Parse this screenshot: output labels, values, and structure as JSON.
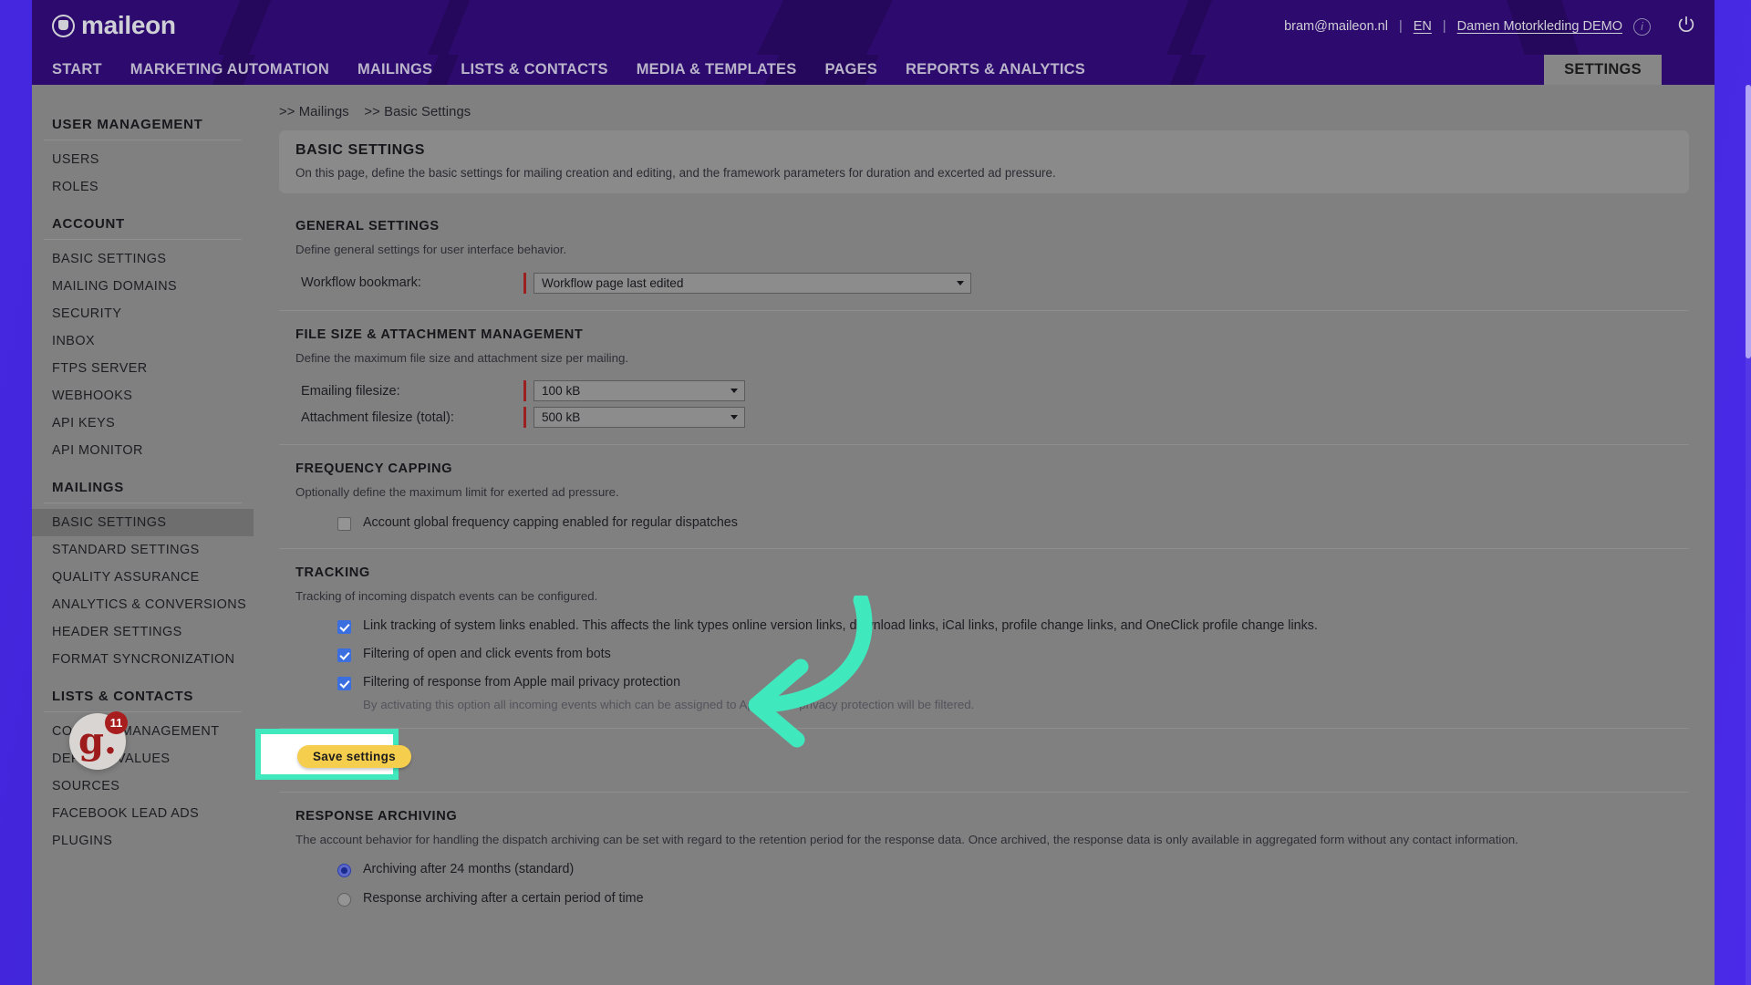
{
  "brand": {
    "name": "maileon",
    "mark_icon": "maileon-logo-icon"
  },
  "header": {
    "user_email": "bram@maileon.nl",
    "separator": "|",
    "language": "EN",
    "account": "Damen Motorkleding DEMO",
    "info_icon": "info-icon",
    "power_icon": "power-icon"
  },
  "nav": {
    "items": [
      {
        "label": "START"
      },
      {
        "label": "MARKETING AUTOMATION"
      },
      {
        "label": "MAILINGS"
      },
      {
        "label": "LISTS & CONTACTS"
      },
      {
        "label": "MEDIA & TEMPLATES"
      },
      {
        "label": "PAGES"
      },
      {
        "label": "REPORTS & ANALYTICS"
      }
    ],
    "active_tab": "SETTINGS"
  },
  "sidebar": {
    "groups": [
      {
        "heading": "USER MANAGEMENT",
        "items": [
          {
            "label": "USERS",
            "selected": false
          },
          {
            "label": "ROLES",
            "selected": false
          }
        ]
      },
      {
        "heading": "ACCOUNT",
        "items": [
          {
            "label": "BASIC SETTINGS",
            "selected": false
          },
          {
            "label": "MAILING DOMAINS",
            "selected": false
          },
          {
            "label": "SECURITY",
            "selected": false
          },
          {
            "label": "INBOX",
            "selected": false
          },
          {
            "label": "FTPS SERVER",
            "selected": false
          },
          {
            "label": "WEBHOOKS",
            "selected": false
          },
          {
            "label": "API KEYS",
            "selected": false
          },
          {
            "label": "API MONITOR",
            "selected": false
          }
        ]
      },
      {
        "heading": "MAILINGS",
        "items": [
          {
            "label": "BASIC SETTINGS",
            "selected": true
          },
          {
            "label": "STANDARD SETTINGS",
            "selected": false
          },
          {
            "label": "QUALITY ASSURANCE",
            "selected": false
          },
          {
            "label": "ANALYTICS & CONVERSIONS",
            "selected": false
          },
          {
            "label": "HEADER SETTINGS",
            "selected": false
          },
          {
            "label": "FORMAT SYNCRONIZATION",
            "selected": false
          }
        ]
      },
      {
        "heading": "LISTS & CONTACTS",
        "items": [
          {
            "label": "CONTACT MANAGEMENT",
            "selected": false
          },
          {
            "label": "DEFAULT VALUES",
            "selected": false
          },
          {
            "label": "SOURCES",
            "selected": false
          },
          {
            "label": "FACEBOOK LEAD ADS",
            "selected": false
          },
          {
            "label": "PLUGINS",
            "selected": false
          }
        ]
      }
    ]
  },
  "help_widget": {
    "glyph": "g.",
    "badge_count": "11",
    "icon": "gorgias-chat-icon"
  },
  "breadcrumb": {
    "first": ">> Mailings",
    "second": ">> Basic Settings"
  },
  "banner": {
    "title": "BASIC SETTINGS",
    "description": "On this page, define the basic settings for mailing creation and editing, and the framework parameters for duration and excerted ad pressure."
  },
  "general_settings": {
    "title": "GENERAL SETTINGS",
    "description": "Define general settings for user interface behavior.",
    "workflow_bookmark_label": "Workflow bookmark:",
    "workflow_bookmark_value": "Workflow page last edited"
  },
  "file_size": {
    "title": "FILE SIZE & ATTACHMENT MANAGEMENT",
    "description": "Define the maximum file size and attachment size per mailing.",
    "emailing_label": "Emailing filesize:",
    "emailing_value": "100 kB",
    "attachment_label": "Attachment filesize (total):",
    "attachment_value": "500 kB"
  },
  "frequency_capping": {
    "title": "FREQUENCY CAPPING",
    "description": "Optionally define the maximum limit for exerted ad pressure.",
    "checkbox_label": "Account global frequency capping enabled for regular dispatches",
    "checked": false
  },
  "tracking": {
    "title": "TRACKING",
    "description": "Tracking of incoming dispatch events can be configured.",
    "options": [
      {
        "label": "Link tracking of system links enabled. This affects the link types online version links, download links, iCal links, profile change links, and OneClick profile change links.",
        "checked": true
      },
      {
        "label": "Filtering of open and click events from bots",
        "checked": true
      },
      {
        "label": "Filtering of response from Apple mail privacy protection",
        "checked": true
      }
    ],
    "apple_note": "By activating this option all incoming events which can be assigned to Apple mail privacy protection will be filtered."
  },
  "save": {
    "label": "Save settings",
    "highlight_color": "#3fe8bd",
    "button_color": "#f5ce4e"
  },
  "annotation": {
    "arrow_color": "#3fe8bd",
    "arrow_icon": "curved-arrow-left-icon"
  },
  "response_archiving": {
    "title": "RESPONSE ARCHIVING",
    "description": "The account behavior for handling the dispatch archiving can be set with regard to the retention period for the response data. Once archived, the response data is only available in aggregated form without any contact information.",
    "options": [
      {
        "label": "Archiving after 24 months (standard)",
        "selected": true
      },
      {
        "label": "Response archiving after a certain period of time",
        "selected": false
      }
    ]
  }
}
